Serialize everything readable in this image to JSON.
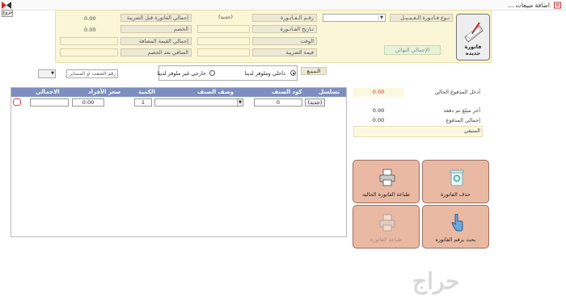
{
  "window": {
    "title": "اضافة مبيعات ...",
    "exit_label": "خروج"
  },
  "header": {
    "new_invoice_label": "فاتورة جديده",
    "invoice_type_label": "نـوع فـاتـورة الـعـمـيـل",
    "invoice_number_label": "رقـم الـفـاتـورة",
    "invoice_number_value": "(جديد)",
    "invoice_date_label": "تـاريخ الفـاتـورة",
    "time_label": "الوقت",
    "tax_amount_label": "قيمة الضريبة",
    "total_before_tax_label": "إجمالي الفاتورة قبل الضريبة",
    "total_before_tax_value": "0.00",
    "discount_label": "الخصم",
    "discount_value": "0.00",
    "value_added_total_label": "إجمالي القيمة المضافة",
    "net_after_discount_label": "الصافي بعد الخصم",
    "grand_total_label": "الإجمالي النهائي"
  },
  "sale_type": {
    "label": "الـبـيـع",
    "option_local": "داخلي وملوفر لدينا",
    "option_external": "خارجي غير ملوفر لدينا",
    "selected": "local"
  },
  "shift": {
    "placeholder": "رقم الشفت او المساير"
  },
  "grid": {
    "columns": {
      "serial": "تسلسل",
      "item_code": "كود الصنف",
      "item_desc": "وصف الصنف",
      "qty": "الكمية",
      "unit_price": "سعر الأفراد",
      "total": "الاجمالي"
    },
    "row": {
      "serial": "(جديد)",
      "item_code": "0",
      "qty": "1",
      "unit_price": "0.00",
      "total": ""
    }
  },
  "summary": {
    "current_paid_label": "أدخل المدفوع الحالي",
    "current_paid_value": "0.00",
    "remaining_label": "أخر مبلغ تم دفعه",
    "remaining_value": "0.00",
    "total_paid_label": "إجمالي المدفوع",
    "total_paid_value": "0.00",
    "balance_label": "المتبقي",
    "balance_value": ""
  },
  "actions": {
    "delete_invoice": "حذف الفاتورة",
    "print_current": "طباعة الفاتورة الحاليه",
    "search_invoice": "بحث برقم الفاتوره",
    "print_disabled": "طباعة الفاتورة"
  },
  "watermark": "حراج",
  "colors": {
    "header_bg": "#fbf6d6",
    "grid_header": "#7d8fc0",
    "tile_bg": "#e9b9a4",
    "current_paid_value": "#cc2222"
  }
}
